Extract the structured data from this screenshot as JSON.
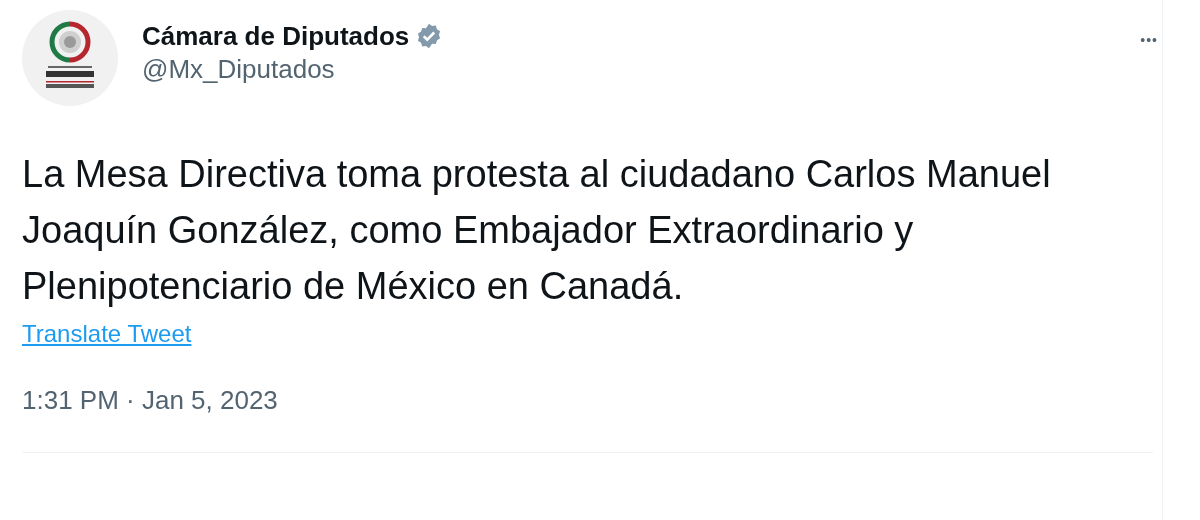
{
  "author": {
    "name": "Cámara de Diputados",
    "verified": true,
    "handle": "@Mx_Diputados"
  },
  "more_menu": "•••",
  "body": "La Mesa Directiva toma protesta al ciudadano Carlos Manuel Joaquín González, como Embajador Extraordinario y Plenipotenciario de México en Canadá.",
  "translate_link": "Translate Tweet",
  "timestamp": "1:31 PM · Jan 5, 2023"
}
